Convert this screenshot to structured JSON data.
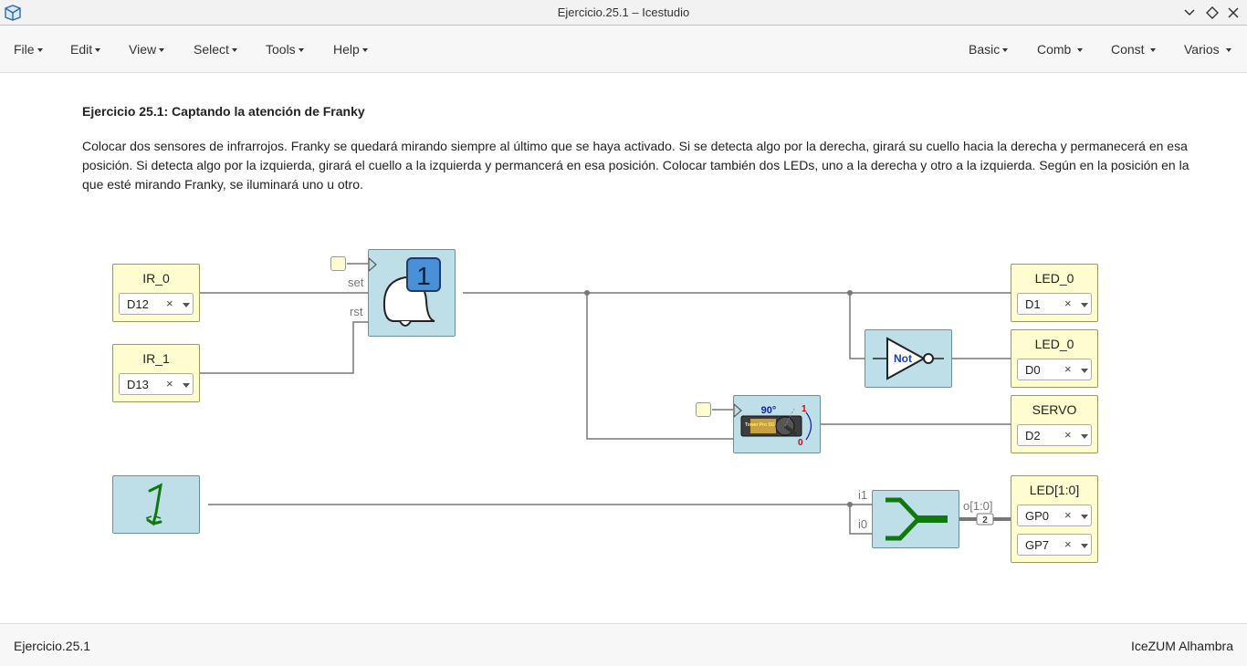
{
  "window": {
    "title": "Ejercicio.25.1 – Icestudio"
  },
  "menu_left": [
    "File",
    "Edit",
    "View",
    "Select",
    "Tools",
    "Help"
  ],
  "menu_right": [
    "Basic",
    "Comb",
    "Const",
    "Varios"
  ],
  "info": {
    "title": "Ejercicio 25.1: Captando la atención de Franky",
    "text": "Colocar dos sensores de infrarrojos. Franky se quedará mirando siempre al último que se haya activado. Si se detecta algo por la derecha, girará su cuello hacia la derecha y permanecerá en esa posición. Si detecta algo por la izquierda, girará el cuello a la izquierda y permancerá en esa posición. Colocar también dos LEDs, uno a la derecha y otro a la izquierda. Según en la posición en la que esté mirando Franky, se iluminará uno u otro."
  },
  "inputs": {
    "ir0": {
      "name": "IR_0",
      "pin": "D12"
    },
    "ir1": {
      "name": "IR_1",
      "pin": "D13"
    }
  },
  "outputs": {
    "led0a": {
      "name": "LED_0",
      "pin": "D1"
    },
    "led0b": {
      "name": "LED_0",
      "pin": "D0"
    },
    "servo": {
      "name": "SERVO",
      "pin": "D2"
    },
    "leds": {
      "name": "LED[1:0]",
      "pins": [
        "GP0",
        "GP7"
      ]
    }
  },
  "flipflop": {
    "set_label": "set",
    "rst_label": "rst",
    "digit": "1"
  },
  "not_gate": {
    "label": "Not"
  },
  "servo_block": {
    "angle": "90°",
    "one": "1",
    "zero": "0",
    "brand": "Tower Pro SG-90"
  },
  "const_block": {
    "glyph": "1"
  },
  "join": {
    "in1": "i1",
    "in0": "i0",
    "out": "o[1:0]",
    "bus": "2"
  },
  "status": {
    "left": "Ejercicio.25.1",
    "right": "IceZUM Alhambra"
  },
  "colors": {
    "io_fill": "#fefdcf",
    "logic_fill": "#bfdfe8",
    "accent": "#9ad3c6",
    "wire": "#777777",
    "join_green": "#0e7a0e"
  },
  "icons": [
    "icestudio-logo-icon",
    "minimize-icon",
    "maximize-icon",
    "close-icon",
    "bell-icon",
    "servo-icon",
    "not-gate-icon",
    "join-bus-icon",
    "constant-one-icon"
  ]
}
